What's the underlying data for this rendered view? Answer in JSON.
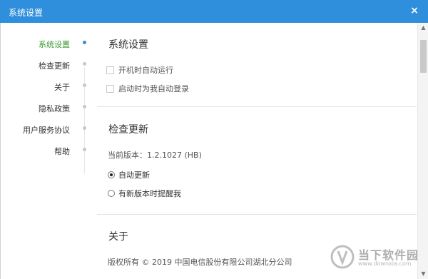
{
  "window": {
    "title": "系统设置",
    "close_glyph": "×"
  },
  "sidebar": {
    "items": [
      {
        "label": "系统设置",
        "active": true
      },
      {
        "label": "检查更新",
        "active": false
      },
      {
        "label": "关于",
        "active": false
      },
      {
        "label": "隐私政策",
        "active": false
      },
      {
        "label": "用户服务协议",
        "active": false
      },
      {
        "label": "帮助",
        "active": false
      }
    ]
  },
  "main": {
    "system": {
      "title": "系统设置",
      "options": [
        {
          "label": "开机时自动运行",
          "checked": false
        },
        {
          "label": "启动时为我自动登录",
          "checked": false
        }
      ]
    },
    "update": {
      "title": "检查更新",
      "version_line": "当前版本：1.2.1027 (HB)",
      "radios": [
        {
          "label": "自动更新",
          "checked": true
        },
        {
          "label": "有新版本时提醒我",
          "checked": false
        }
      ]
    },
    "about": {
      "title": "关于",
      "copyright": "版权所有 © 2019 中国电信股份有限公司湖北分公司"
    }
  },
  "watermark": {
    "text": "当下软件园",
    "sub": "www.downxia.com"
  },
  "colors": {
    "titlebar": "#2f8fdc",
    "active_nav": "#3a9a2e",
    "active_dot": "#2f8fdc"
  }
}
